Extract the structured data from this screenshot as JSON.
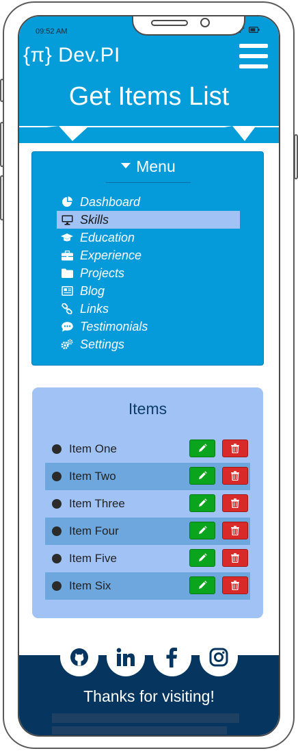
{
  "status_bar": {
    "time": "09:52 AM"
  },
  "header": {
    "brand": "{π} Dev.PI",
    "page_title": "Get Items List"
  },
  "menu": {
    "heading": "Menu",
    "items": [
      {
        "label": "Dashboard",
        "icon": "chart-pie-icon",
        "active": false
      },
      {
        "label": "Skills",
        "icon": "desktop-icon",
        "active": true
      },
      {
        "label": "Education",
        "icon": "graduation-cap-icon",
        "active": false
      },
      {
        "label": "Experience",
        "icon": "briefcase-icon",
        "active": false
      },
      {
        "label": "Projects",
        "icon": "folder-icon",
        "active": false
      },
      {
        "label": "Blog",
        "icon": "newspaper-icon",
        "active": false
      },
      {
        "label": "Links",
        "icon": "link-icon",
        "active": false
      },
      {
        "label": "Testimonials",
        "icon": "comment-dots-icon",
        "active": false
      },
      {
        "label": "Settings",
        "icon": "cogs-icon",
        "active": false
      }
    ]
  },
  "items_panel": {
    "title": "Items",
    "rows": [
      {
        "label": "Item One"
      },
      {
        "label": "Item Two"
      },
      {
        "label": "Item Three"
      },
      {
        "label": "Item Four"
      },
      {
        "label": "Item Five"
      },
      {
        "label": "Item Six"
      }
    ]
  },
  "footer": {
    "socials": [
      "github-icon",
      "linkedin-icon",
      "facebook-icon",
      "instagram-icon"
    ],
    "thanks": "Thanks for visiting!"
  },
  "colors": {
    "header_blue": "#049cd9",
    "menu_blue": "#059ada",
    "panel_light_blue": "#a1c2f5",
    "row_alt_blue": "#6da7dd",
    "edit_green": "#0aa51c",
    "delete_red": "#d92a2a",
    "footer_navy": "#06365f"
  }
}
